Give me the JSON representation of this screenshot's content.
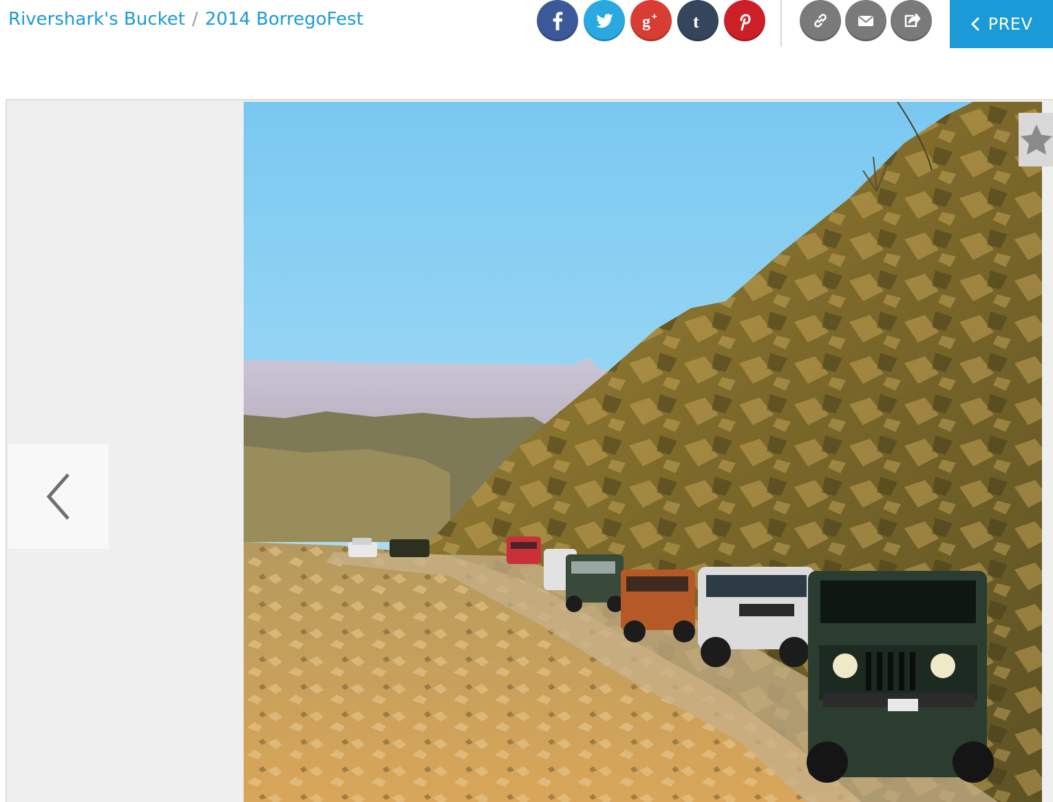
{
  "breadcrumb": {
    "bucket": "Rivershark's Bucket",
    "separator": "/",
    "album": "2014 BorregoFest"
  },
  "share": {
    "social": [
      {
        "name": "facebook",
        "icon": "facebook-icon",
        "color": "#3b5998"
      },
      {
        "name": "twitter",
        "icon": "twitter-icon",
        "color": "#2aa9e0"
      },
      {
        "name": "google-plus",
        "icon": "google-plus-icon",
        "color": "#d73d32"
      },
      {
        "name": "tumblr",
        "icon": "tumblr-icon",
        "color": "#35465c"
      },
      {
        "name": "pinterest",
        "icon": "pinterest-icon",
        "color": "#cb2027"
      }
    ],
    "utility": [
      {
        "name": "link",
        "icon": "link-icon",
        "color": "#7a7a7a"
      },
      {
        "name": "email",
        "icon": "email-icon",
        "color": "#7a7a7a"
      },
      {
        "name": "share",
        "icon": "share-icon",
        "color": "#7a7a7a"
      }
    ]
  },
  "nav": {
    "prev_label": "PREV",
    "accent": "#1a9ad6"
  },
  "viewer": {
    "background": "#efefef",
    "prev_arrow_icon": "chevron-left-icon",
    "favorite_icon": "star-icon"
  }
}
